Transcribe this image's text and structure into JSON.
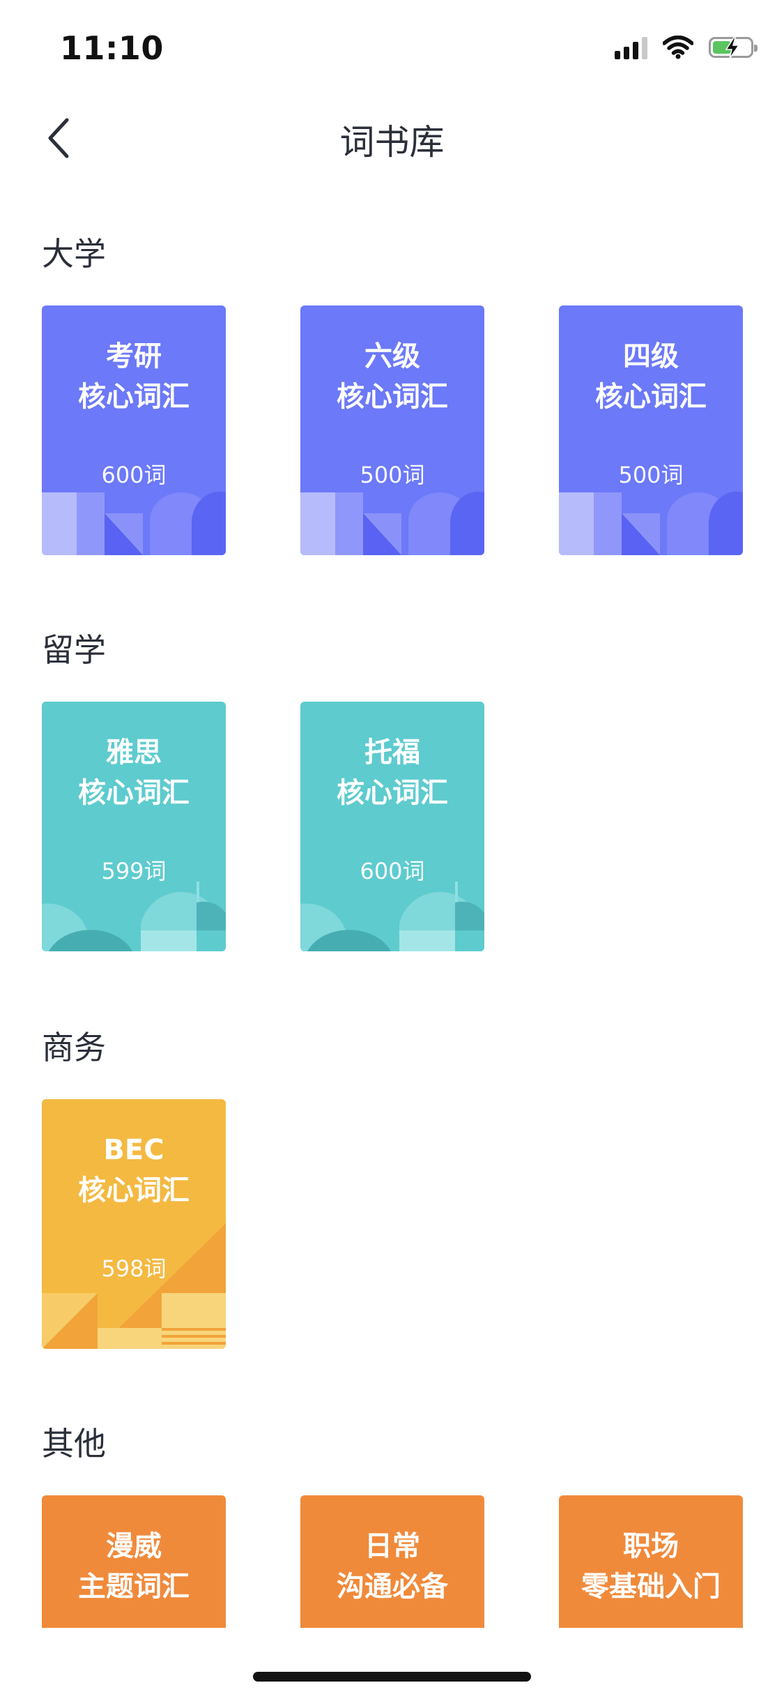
{
  "status_bar": {
    "time": "11:10"
  },
  "nav": {
    "title": "词书库"
  },
  "sections": [
    {
      "title": "大学",
      "books": [
        {
          "line1": "考研",
          "line2": "核心词汇",
          "count": "600词"
        },
        {
          "line1": "六级",
          "line2": "核心词汇",
          "count": "500词"
        },
        {
          "line1": "四级",
          "line2": "核心词汇",
          "count": "500词"
        }
      ]
    },
    {
      "title": "留学",
      "books": [
        {
          "line1": "雅思",
          "line2": "核心词汇",
          "count": "599词"
        },
        {
          "line1": "托福",
          "line2": "核心词汇",
          "count": "600词"
        }
      ]
    },
    {
      "title": "商务",
      "books": [
        {
          "line1": "BEC",
          "line2": "核心词汇",
          "count": "598词"
        }
      ]
    },
    {
      "title": "其他",
      "books": [
        {
          "line1": "漫威",
          "line2": "主题词汇"
        },
        {
          "line1": "日常",
          "line2": "沟通必备"
        },
        {
          "line1": "职场",
          "line2": "零基础入门"
        }
      ]
    }
  ],
  "colors": {
    "university": "#6c79f8",
    "study_abroad": "#5ecbce",
    "business": "#f4b941",
    "other": "#f08a3b"
  }
}
